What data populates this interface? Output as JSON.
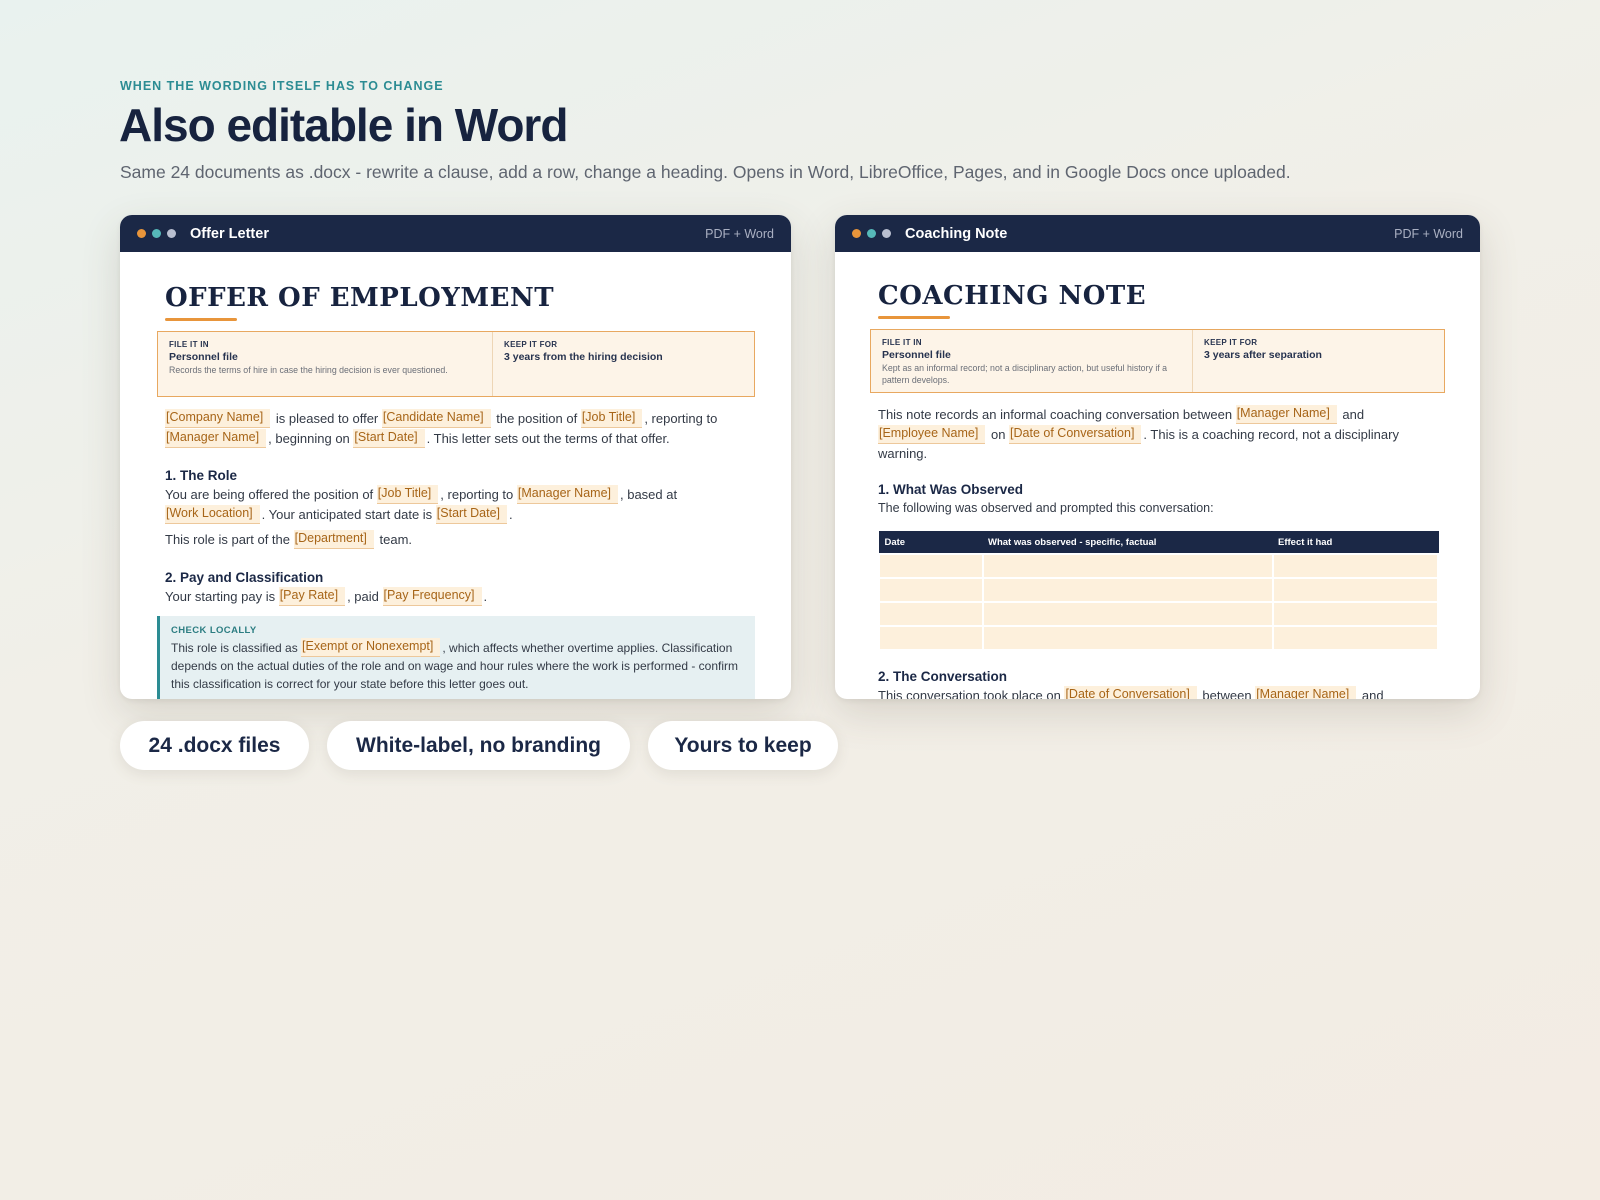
{
  "header": {
    "eyebrow": "WHEN THE WORDING ITSELF HAS TO CHANGE",
    "title": "Also editable in Word",
    "subtitle": "Same 24 documents as .docx - rewrite a clause, add a row, change a heading. Opens in Word, LibreOffice, Pages, and in Google Docs once uploaded."
  },
  "offer_card": {
    "window_title": "Offer Letter",
    "tag": "PDF + Word",
    "doc_title": "OFFER OF EMPLOYMENT",
    "file_label": "FILE IT IN",
    "file_value": "Personnel file",
    "file_note": "Records the terms of hire in case the hiring decision is ever questioned.",
    "keep_label": "KEEP IT FOR",
    "keep_value": "3 years from the hiring decision",
    "intro": {
      "company": "[Company Name]",
      "t1": " is pleased to offer ",
      "candidate": "[Candidate Name]",
      "t2": " the position of ",
      "job": "[Job Title]",
      "t3": ", reporting to ",
      "manager": "[Manager Name]",
      "t4": ", beginning on ",
      "start": "[Start Date]",
      "t5": ". This letter sets out the terms of that offer."
    },
    "role": {
      "heading": "1. The Role",
      "t1": "You are being offered the position of ",
      "job": "[Job Title]",
      "t2": ", reporting to ",
      "manager": "[Manager Name]",
      "t3": ", based at ",
      "location": "[Work Location]",
      "t4": ". Your anticipated start date is ",
      "start": "[Start Date]",
      "t5": ".",
      "t6": "This role is part of the ",
      "department": "[Department]",
      "t7": " team."
    },
    "pay": {
      "heading": "2. Pay and Classification",
      "t1": "Your starting pay is ",
      "rate": "[Pay Rate]",
      "t2": ", paid ",
      "frequency": "[Pay Frequency]",
      "t3": "."
    },
    "callout": {
      "label": "CHECK LOCALLY",
      "t1": "This role is classified as ",
      "exempt": "[Exempt or Nonexempt]",
      "t2": ", which affects whether overtime applies. Classification depends on the actual duties of the role and on wage and hour rules where the work is performed - confirm this classification is correct for your state before this letter goes out."
    }
  },
  "coaching_card": {
    "window_title": "Coaching Note",
    "tag": "PDF + Word",
    "doc_title": "COACHING NOTE",
    "file_label": "FILE IT IN",
    "file_value": "Personnel file",
    "file_note": "Kept as an informal record; not a disciplinary action, but useful history if a pattern develops.",
    "keep_label": "KEEP IT FOR",
    "keep_value": "3 years after separation",
    "intro": {
      "t1": "This note records an informal coaching conversation between ",
      "manager": "[Manager Name]",
      "t2": " and ",
      "employee": "[Employee Name]",
      "t3": " on ",
      "date": "[Date of Conversation]",
      "t4": ". This is a coaching record, not a disciplinary warning."
    },
    "observed": {
      "heading": "1. What Was Observed",
      "text": "The following was observed and prompted this conversation:",
      "columns": [
        "Date",
        "What was observed - specific, factual",
        "Effect it had"
      ]
    },
    "conversation": {
      "heading": "2. The Conversation",
      "t1": "This conversation took place on ",
      "date": "[Date of Conversation]",
      "t2": " between ",
      "manager": "[Manager Name]",
      "t3": " and"
    }
  },
  "pills": [
    "24 .docx files",
    "White-label, no branding",
    "Yours to keep"
  ],
  "colors": {
    "navy": "#1b2846",
    "accent_orange": "#e8953b",
    "accent_teal": "#2c8c93",
    "placeholder_bg": "#fdf0dc",
    "placeholder_text": "#a76518"
  }
}
